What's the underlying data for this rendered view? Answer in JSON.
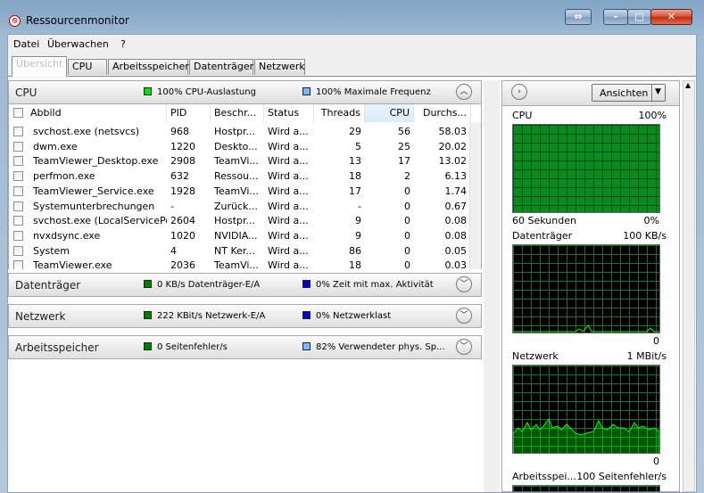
{
  "window": {
    "title": "Ressourcenmonitor"
  },
  "menu": [
    "Datei",
    "Überwachen",
    "?"
  ],
  "tabs": [
    "Übersicht",
    "CPU",
    "Arbeitsspeicher",
    "Datenträger",
    "Netzwerk"
  ],
  "cpu": {
    "title": "CPU",
    "legend1": "100% CPU-Auslastung",
    "legend1_color": "#00e000",
    "legend2": "100% Maximale Frequenz",
    "legend2_color": "#7ab8ff",
    "columns": [
      "Abbild",
      "PID",
      "Beschr...",
      "Status",
      "Threads",
      "CPU",
      "Durchs..."
    ],
    "rows": [
      [
        "svchost.exe (netsvcs)",
        "968",
        "Hostpr...",
        "Wird a...",
        "29",
        "56",
        "58.03"
      ],
      [
        "dwm.exe",
        "1220",
        "Deskto...",
        "Wird a...",
        "5",
        "25",
        "20.02"
      ],
      [
        "TeamViewer_Desktop.exe",
        "2908",
        "TeamVi...",
        "Wird a...",
        "13",
        "17",
        "13.02"
      ],
      [
        "perfmon.exe",
        "632",
        "Ressou...",
        "Wird a...",
        "18",
        "2",
        "6.13"
      ],
      [
        "TeamViewer_Service.exe",
        "1928",
        "TeamVi...",
        "Wird a...",
        "17",
        "0",
        "1.74"
      ],
      [
        "Systemunterbrechungen",
        "-",
        "Zurück...",
        "Wird a...",
        "-",
        "0",
        "0.67"
      ],
      [
        "svchost.exe (LocalServicePee...",
        "2604",
        "Hostpr...",
        "Wird a...",
        "9",
        "0",
        "0.08"
      ],
      [
        "nvxdsync.exe",
        "1020",
        "NVIDIA...",
        "Wird a...",
        "9",
        "0",
        "0.08"
      ],
      [
        "System",
        "4",
        "NT Ker...",
        "Wird a...",
        "86",
        "0",
        "0.05"
      ],
      [
        "TeamViewer.exe",
        "2036",
        "TeamVi...",
        "Wird a...",
        "18",
        "0",
        "0.03"
      ]
    ]
  },
  "disk": {
    "title": "Datenträger",
    "legend1": "0 KB/s Datenträger-E/A",
    "legend1_color": "#008000",
    "legend2": "0% Zeit mit max. Aktivität",
    "legend2_color": "#0000c0"
  },
  "network": {
    "title": "Netzwerk",
    "legend1": "222 KBit/s Netzwerk-E/A",
    "legend1_color": "#008000",
    "legend2": "0% Netzwerklast",
    "legend2_color": "#0000c0"
  },
  "memory": {
    "title": "Arbeitsspeicher",
    "legend1": "0 Seitenfehler/s",
    "legend1_color": "#008000",
    "legend2": "82% Verwendeter phys. Sp...",
    "legend2_color": "#7ab8ff"
  },
  "right": {
    "views_label": "Ansichten",
    "graphs": [
      {
        "name": "CPU",
        "max": "100%",
        "footer_left": "60 Sekunden",
        "footer_right": "0%"
      },
      {
        "name": "Datenträger",
        "max": "100 KB/s",
        "footer_right": "0"
      },
      {
        "name": "Netzwerk",
        "max": "1 MBit/s",
        "footer_right": "0"
      },
      {
        "name": "Arbeitsspei...",
        "max": "100 Seitenfehler/s"
      }
    ]
  }
}
